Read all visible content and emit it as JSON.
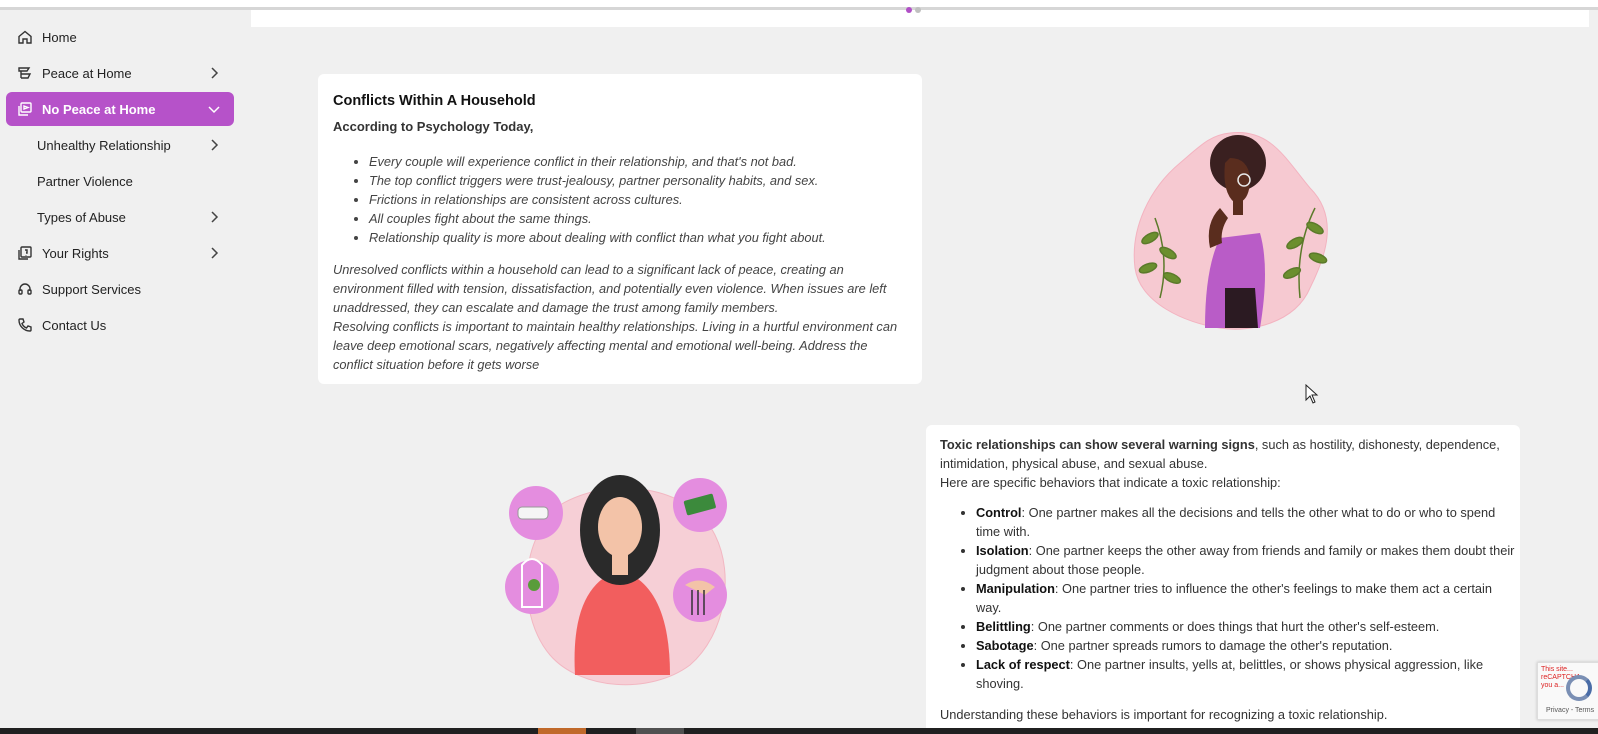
{
  "sidebar": {
    "items": [
      {
        "label": "Home",
        "icon": "home-icon"
      },
      {
        "label": "Peace at Home",
        "icon": "peace-icon",
        "chevron": "right"
      },
      {
        "label": "No Peace at Home",
        "icon": "gallery-icon",
        "chevron": "down",
        "active": true
      },
      {
        "label": "Unhealthy Relationship",
        "chevron": "right"
      },
      {
        "label": "Partner Violence"
      },
      {
        "label": "Types of Abuse",
        "chevron": "right"
      },
      {
        "label": "Your Rights",
        "icon": "rights-icon",
        "chevron": "right"
      },
      {
        "label": "Support Services",
        "icon": "headset-icon"
      },
      {
        "label": "Contact Us",
        "icon": "phone-icon"
      }
    ],
    "accent": "#b652c9"
  },
  "card1": {
    "title": "Conflicts Within A Household",
    "subtitle": "According to Psychology Today,",
    "bullets": [
      "Every couple will experience conflict in their relationship, and that's not bad.",
      "The top conflict triggers were trust-jealousy, partner personality habits, and sex.",
      "Frictions in relationships are consistent across cultures.",
      "All couples fight about the same things.",
      "Relationship quality is more about dealing with conflict than what you fight about."
    ],
    "paragraph1": "Unresolved conflicts within a household can lead to a significant lack of peace, creating an environment filled with tension, dissatisfaction, and potentially even violence. When issues are left unaddressed, they can escalate and damage the trust among family members.",
    "paragraph2": "Resolving conflicts is important to maintain healthy relationships. Living in a hurtful environment can leave deep emotional scars, negatively affecting mental and emotional well-being. Address the conflict situation before it gets worse"
  },
  "card2": {
    "intro_bold": "Toxic relationships can show several warning signs",
    "intro_rest": ", such as hostility, dishonesty, dependence, intimidation, physical abuse, and sexual abuse.",
    "intro_line2": "Here are specific behaviors that indicate a toxic relationship:",
    "bullets": [
      {
        "term": "Control",
        "text": ": One partner makes all the decisions and tells the other what to do or who to spend time with."
      },
      {
        "term": "Isolation",
        "text": ": One partner keeps the other away from friends and family or makes them doubt their judgment about those people."
      },
      {
        "term": "Manipulation",
        "text": ": One partner tries to influence the other's feelings to make them act a certain way."
      },
      {
        "term": "Belittling",
        "text": ": One partner comments or does things that hurt the other's self-esteem."
      },
      {
        "term": "Sabotage",
        "text": ": One partner spreads rumors to damage the other's reputation."
      },
      {
        "term": "Lack of respect",
        "text": ": One partner insults, yells at, belittles, or shows physical aggression, like shoving."
      }
    ],
    "outro": "Understanding these behaviors is important for recognizing a toxic relationship."
  },
  "recaptcha": {
    "warning": "This site... reCAPTCHA ... you a...",
    "terms": "Privacy - Terms"
  }
}
